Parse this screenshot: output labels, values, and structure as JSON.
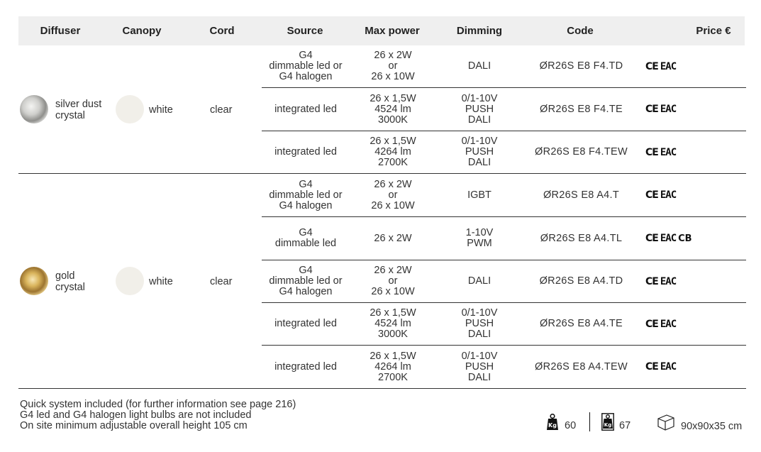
{
  "header": {
    "diffuser": "Diffuser",
    "canopy": "Canopy",
    "cord": "Cord",
    "source": "Source",
    "max_power": "Max power",
    "dimming": "Dimming",
    "code": "Code",
    "price": "Price €"
  },
  "groups": [
    {
      "diffuser": [
        "silver dust",
        "crystal"
      ],
      "canopy": "white",
      "cord": "clear",
      "rows": [
        {
          "source": [
            "G4",
            "dimmable led or",
            "G4 halogen"
          ],
          "power": [
            "26 x 2W",
            "or",
            "26 x 10W"
          ],
          "dimming": [
            "DALI"
          ],
          "code": "ØR26S E8 F4.TD",
          "marks": [
            "CE",
            "EAC"
          ]
        },
        {
          "source": [
            "integrated led"
          ],
          "power": [
            "26 x 1,5W",
            "4524 lm",
            "3000K"
          ],
          "dimming": [
            "0/1-10V",
            "PUSH",
            "DALI"
          ],
          "code": "ØR26S E8 F4.TE",
          "marks": [
            "CE",
            "EAC"
          ]
        },
        {
          "source": [
            "integrated led"
          ],
          "power": [
            "26 x 1,5W",
            "4264 lm",
            "2700K"
          ],
          "dimming": [
            "0/1-10V",
            "PUSH",
            "DALI"
          ],
          "code": "ØR26S E8 F4.TEW",
          "marks": [
            "CE",
            "EAC"
          ]
        }
      ]
    },
    {
      "diffuser": [
        "gold",
        "crystal"
      ],
      "canopy": "white",
      "cord": "clear",
      "rows": [
        {
          "source": [
            "G4",
            "dimmable led or",
            "G4 halogen"
          ],
          "power": [
            "26 x 2W",
            "or",
            "26 x 10W"
          ],
          "dimming": [
            "IGBT"
          ],
          "code": "ØR26S E8 A4.T",
          "marks": [
            "CE",
            "EAC"
          ]
        },
        {
          "source": [
            "G4",
            "dimmable led"
          ],
          "power": [
            "26 x 2W"
          ],
          "dimming": [
            "1-10V",
            "PWM"
          ],
          "code": "ØR26S E8 A4.TL",
          "marks": [
            "CE",
            "EAC",
            "CB"
          ]
        },
        {
          "source": [
            "G4",
            "dimmable led or",
            "G4 halogen"
          ],
          "power": [
            "26 x 2W",
            "or",
            "26 x 10W"
          ],
          "dimming": [
            "DALI"
          ],
          "code": "ØR26S E8 A4.TD",
          "marks": [
            "CE",
            "EAC"
          ]
        },
        {
          "source": [
            "integrated led"
          ],
          "power": [
            "26 x 1,5W",
            "4524 lm",
            "3000K"
          ],
          "dimming": [
            "0/1-10V",
            "PUSH",
            "DALI"
          ],
          "code": "ØR26S E8 A4.TE",
          "marks": [
            "CE",
            "EAC"
          ]
        },
        {
          "source": [
            "integrated led"
          ],
          "power": [
            "26 x 1,5W",
            "4264 lm",
            "2700K"
          ],
          "dimming": [
            "0/1-10V",
            "PUSH",
            "DALI"
          ],
          "code": "ØR26S E8 A4.TEW",
          "marks": [
            "CE",
            "EAC"
          ]
        }
      ]
    }
  ],
  "notes": [
    "Quick system included (for further information see page 216)",
    "G4 led and G4 halogen light bulbs are not included",
    "On site minimum adjustable overall height 105 cm"
  ],
  "package": {
    "net_weight_icon": "kg-weight-icon",
    "net_weight": "60",
    "gross_weight_icon": "kg-package-weight-icon",
    "gross_weight": "67",
    "box_icon": "box-icon",
    "dimensions": "90x90x35 cm"
  }
}
